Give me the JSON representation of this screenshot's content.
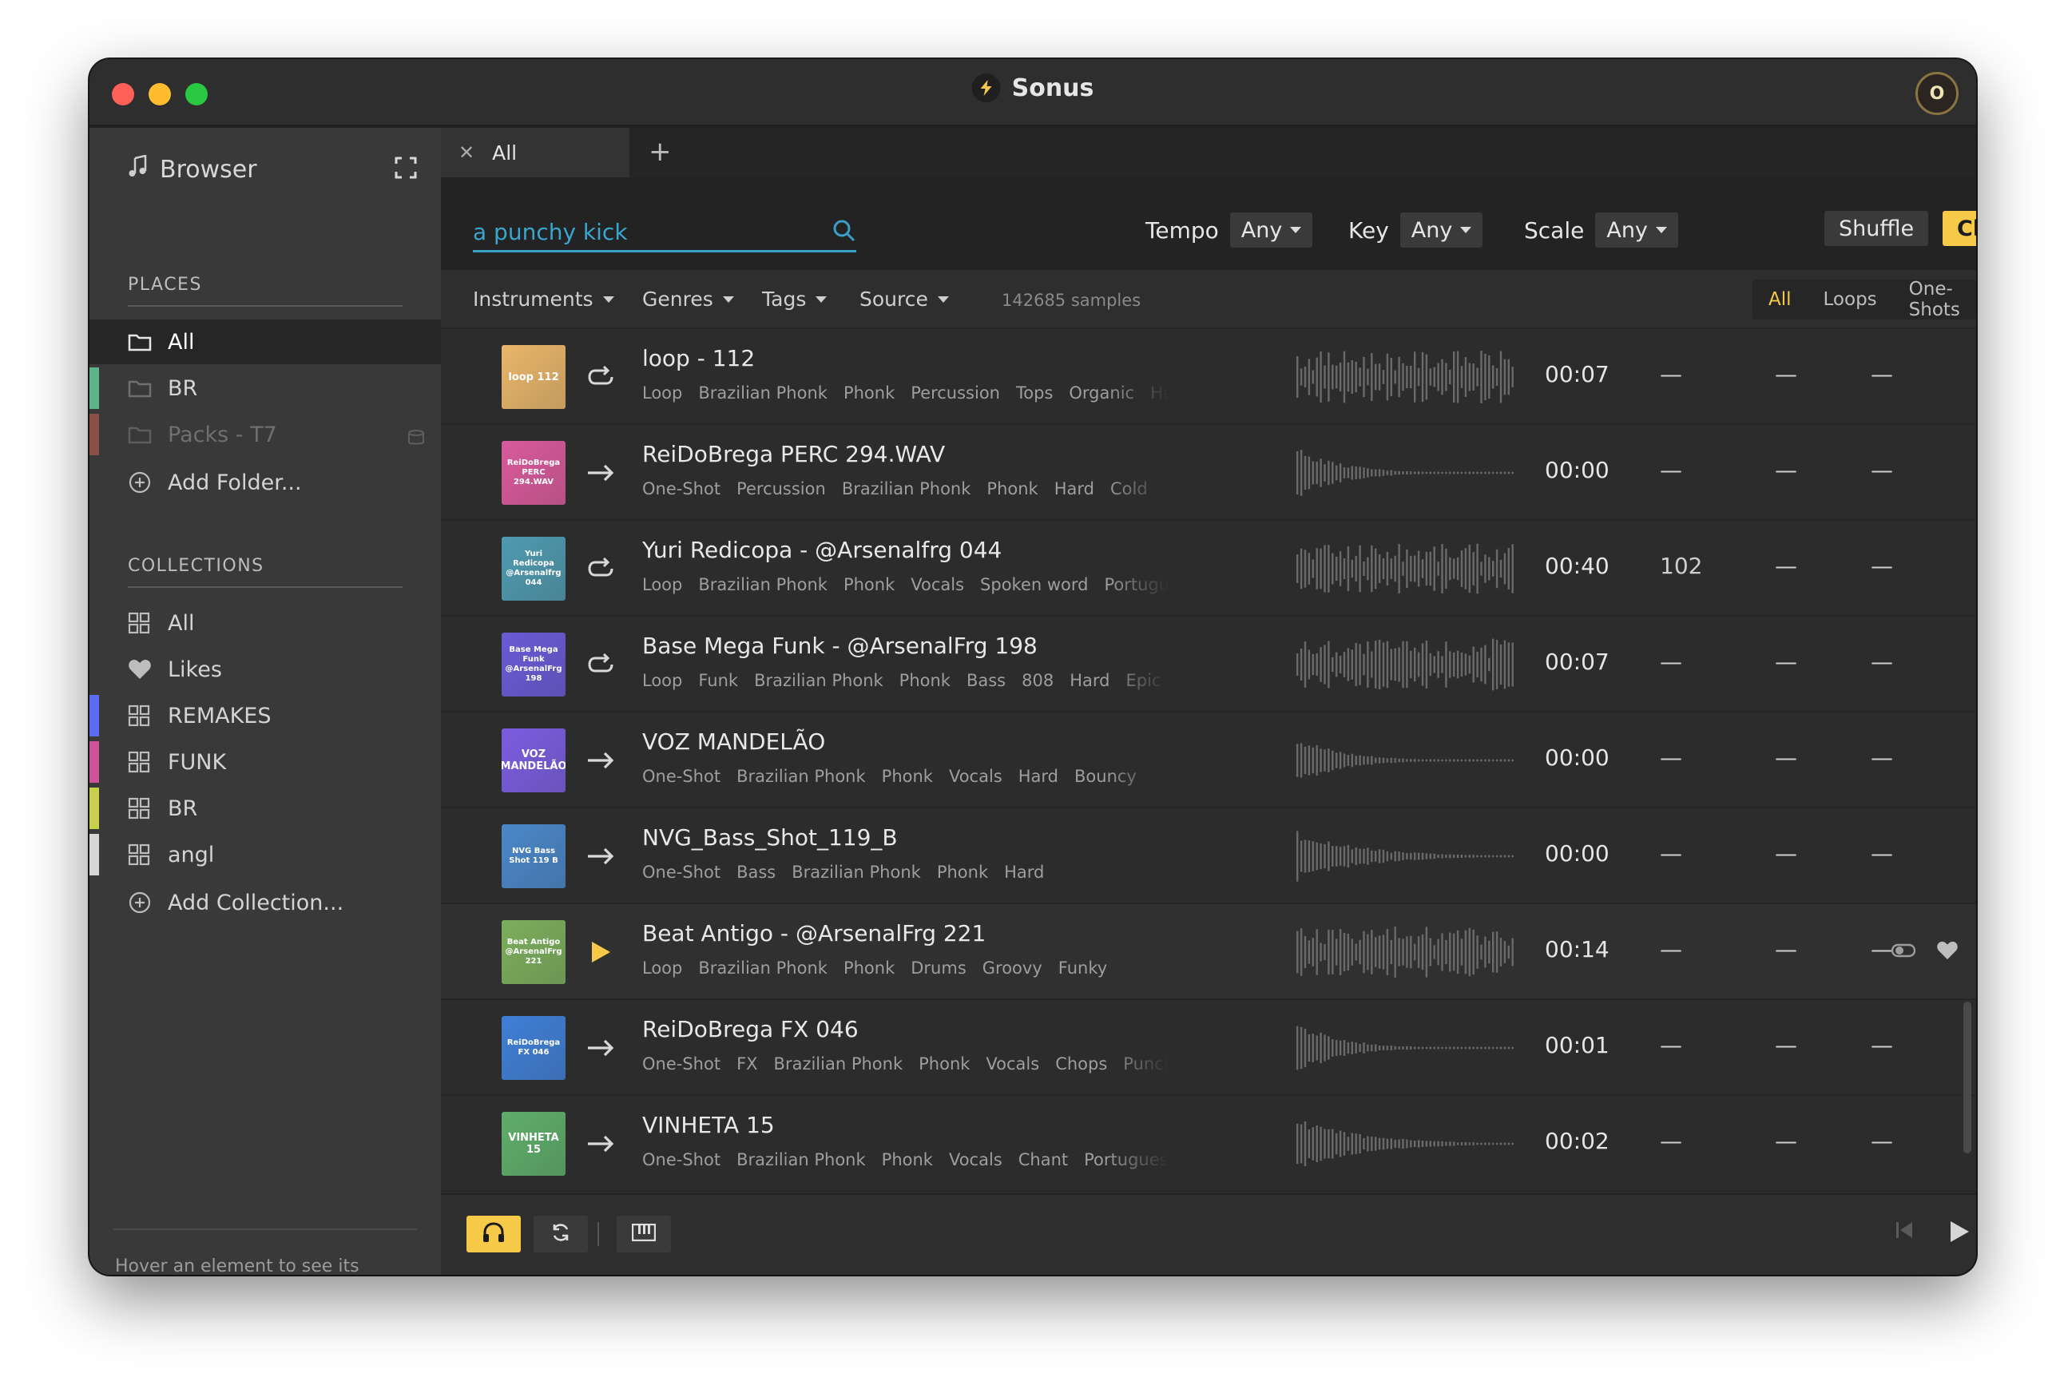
{
  "app": {
    "title": "Sonus",
    "avatar_initial": "O"
  },
  "sidebar": {
    "browser_label": "Browser",
    "places_title": "PLACES",
    "places": [
      {
        "label": "All",
        "color": "",
        "active": true
      },
      {
        "label": "BR",
        "color": "#5fb38a"
      },
      {
        "label": "Packs - T7",
        "color": "#8a4f45",
        "dim": true
      },
      {
        "label": "Add Folder..."
      }
    ],
    "collections_title": "COLLECTIONS",
    "collections": [
      {
        "label": "All"
      },
      {
        "label": "Likes"
      },
      {
        "label": "REMAKES",
        "color": "#5b6cf0"
      },
      {
        "label": "FUNK",
        "color": "#d0539a"
      },
      {
        "label": "BR",
        "color": "#c8d14e"
      },
      {
        "label": "angl",
        "color": "#d6d6d6"
      },
      {
        "label": "Add Collection..."
      }
    ],
    "footer_hint": "Hover an element to see its description"
  },
  "tabs": [
    {
      "label": "All"
    }
  ],
  "search": {
    "value": "a punchy kick",
    "placeholder": "a punchy kick"
  },
  "filters": {
    "tempo_label": "Tempo",
    "tempo_value": "Any",
    "key_label": "Key",
    "key_value": "Any",
    "scale_label": "Scale",
    "scale_value": "Any",
    "shuffle_label": "Shuffle",
    "clear_label": "Clear"
  },
  "facets": {
    "instruments": "Instruments",
    "genres": "Genres",
    "tags": "Tags",
    "source": "Source",
    "count": "142685 samples",
    "segments": [
      "All",
      "Loops",
      "One-Shots"
    ],
    "active_segment": "All"
  },
  "samples": [
    {
      "title": "loop - 112",
      "thumb_text": "loop 112",
      "thumb_color": "#e9b66a",
      "kind": "loop",
      "tags": [
        "Loop",
        "Brazilian Phonk",
        "Phonk",
        "Percussion",
        "Tops",
        "Organic",
        "Hard"
      ],
      "duration": "00:07",
      "bpm": "—",
      "key": "—",
      "scale": "—"
    },
    {
      "title": "ReiDoBrega PERC 294.WAV",
      "thumb_text": "ReiDoBrega PERC 294.WAV",
      "thumb_color": "#d95a9b",
      "kind": "oneshot",
      "tags": [
        "One-Shot",
        "Percussion",
        "Brazilian Phonk",
        "Phonk",
        "Hard",
        "Cold"
      ],
      "duration": "00:00",
      "bpm": "—",
      "key": "—",
      "scale": "—"
    },
    {
      "title": "Yuri Redicopa - @Arsenalfrg 044",
      "thumb_text": "Yuri Redicopa @Arsenalfrg 044",
      "thumb_color": "#4f9ab0",
      "kind": "loop",
      "tags": [
        "Loop",
        "Brazilian Phonk",
        "Phonk",
        "Vocals",
        "Spoken word",
        "Portuguese"
      ],
      "duration": "00:40",
      "bpm": "102",
      "key": "—",
      "scale": "—"
    },
    {
      "title": "Base Mega Funk - @ArsenalFrg 198",
      "thumb_text": "Base Mega Funk @ArsenalFrg 198",
      "thumb_color": "#6a5ad6",
      "kind": "loop",
      "tags": [
        "Loop",
        "Funk",
        "Brazilian Phonk",
        "Phonk",
        "Bass",
        "808",
        "Hard",
        "Epic"
      ],
      "duration": "00:07",
      "bpm": "—",
      "key": "—",
      "scale": "—"
    },
    {
      "title": "VOZ MANDELÃO",
      "thumb_text": "VOZ MANDELÃO",
      "thumb_color": "#7a5de0",
      "kind": "oneshot",
      "tags": [
        "One-Shot",
        "Brazilian Phonk",
        "Phonk",
        "Vocals",
        "Hard",
        "Bouncy"
      ],
      "duration": "00:00",
      "bpm": "—",
      "key": "—",
      "scale": "—"
    },
    {
      "title": "NVG_Bass_Shot_119_B",
      "thumb_text": "NVG Bass Shot 119 B",
      "thumb_color": "#4a87c9",
      "kind": "oneshot",
      "tags": [
        "One-Shot",
        "Bass",
        "Brazilian Phonk",
        "Phonk",
        "Hard"
      ],
      "duration": "00:00",
      "bpm": "—",
      "key": "—",
      "scale": "—"
    },
    {
      "title": "Beat Antigo - @ArsenalFrg 221",
      "thumb_text": "Beat Antigo @ArsenalFrg 221",
      "thumb_color": "#7cae5c",
      "kind": "playing",
      "tags": [
        "Loop",
        "Brazilian Phonk",
        "Phonk",
        "Drums",
        "Groovy",
        "Funky"
      ],
      "duration": "00:14",
      "bpm": "—",
      "key": "—",
      "scale": "—",
      "hover": true
    },
    {
      "title": "ReiDoBrega FX 046",
      "thumb_text": "ReiDoBrega FX 046",
      "thumb_color": "#3f7fd6",
      "kind": "oneshot",
      "tags": [
        "One-Shot",
        "FX",
        "Brazilian Phonk",
        "Phonk",
        "Vocals",
        "Chops",
        "Punchy"
      ],
      "duration": "00:01",
      "bpm": "—",
      "key": "—",
      "scale": "—"
    },
    {
      "title": "VINHETA 15",
      "thumb_text": "VINHETA 15",
      "thumb_color": "#5fae6a",
      "kind": "oneshot",
      "tags": [
        "One-Shot",
        "Brazilian Phonk",
        "Phonk",
        "Vocals",
        "Chant",
        "Portuguese"
      ],
      "duration": "00:02",
      "bpm": "—",
      "key": "—",
      "scale": "—"
    }
  ],
  "colors": {
    "accent": "#f7c948",
    "search": "#39a6cf"
  }
}
